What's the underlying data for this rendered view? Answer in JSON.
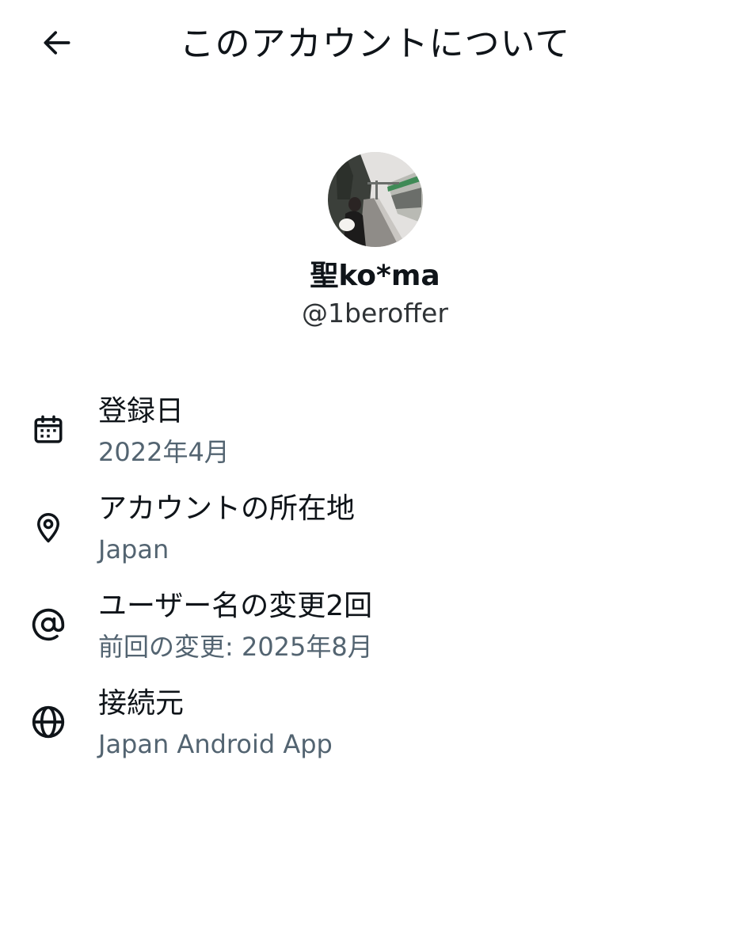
{
  "header": {
    "title": "このアカウントについて",
    "back_icon": "arrow-left-icon"
  },
  "profile": {
    "display_name": "聖ko*ma",
    "handle": "@1beroffer"
  },
  "info": {
    "join_date": {
      "icon": "calendar-icon",
      "label": "登録日",
      "value": "2022年4月"
    },
    "location": {
      "icon": "location-pin-icon",
      "label": "アカウントの所在地",
      "value": "Japan"
    },
    "username_changes": {
      "icon": "at-sign-icon",
      "label": "ユーザー名の変更2回",
      "value": "前回の変更: 2025年8月"
    },
    "connected_via": {
      "icon": "globe-icon",
      "label": "接続元",
      "value": "Japan Android App"
    }
  },
  "colors": {
    "primary_text": "#0f1419",
    "secondary_text": "#536471",
    "background": "#ffffff"
  }
}
